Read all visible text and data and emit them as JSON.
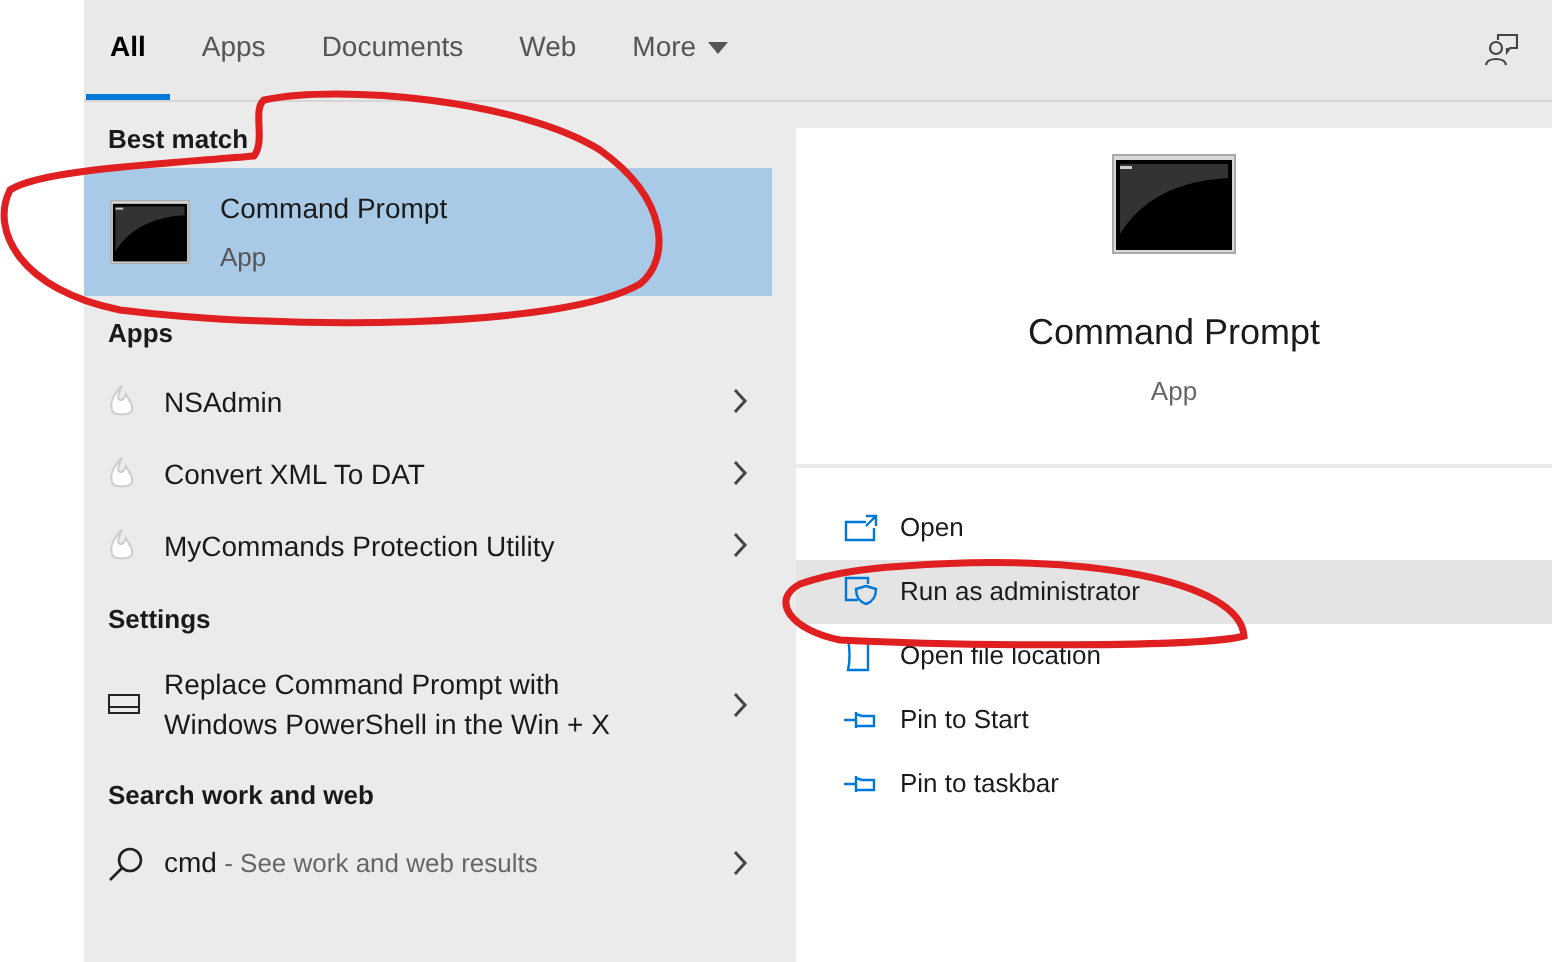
{
  "tabs": [
    {
      "label": "All",
      "selected": true
    },
    {
      "label": "Apps",
      "selected": false
    },
    {
      "label": "Documents",
      "selected": false
    },
    {
      "label": "Web",
      "selected": false
    },
    {
      "label": "More",
      "selected": false,
      "dropdown": true
    }
  ],
  "best_match": {
    "heading": "Best match",
    "title": "Command Prompt",
    "subtitle": "App",
    "selected": true
  },
  "groups": [
    {
      "heading": "Apps",
      "items": [
        {
          "kind": "app",
          "label": "NSAdmin"
        },
        {
          "kind": "app",
          "label": "Convert XML To DAT"
        },
        {
          "kind": "app",
          "label": "MyCommands Protection Utility"
        }
      ]
    },
    {
      "heading": "Settings",
      "items": [
        {
          "kind": "setting",
          "label": "Replace Command Prompt with Windows PowerShell in the Win + X"
        }
      ]
    },
    {
      "heading": "Search work and web",
      "items": [
        {
          "kind": "search",
          "label": "cmd",
          "hint": "- See work and web results"
        }
      ]
    }
  ],
  "detail": {
    "title": "Command Prompt",
    "subtitle": "App",
    "actions": [
      {
        "kind": "open",
        "label": "Open",
        "highlighted": false
      },
      {
        "kind": "admin",
        "label": "Run as administrator",
        "highlighted": true
      },
      {
        "kind": "folder",
        "label": "Open file location",
        "highlighted": false
      },
      {
        "kind": "pin",
        "label": "Pin to Start",
        "highlighted": false
      },
      {
        "kind": "pin",
        "label": "Pin to taskbar",
        "highlighted": false
      }
    ]
  }
}
